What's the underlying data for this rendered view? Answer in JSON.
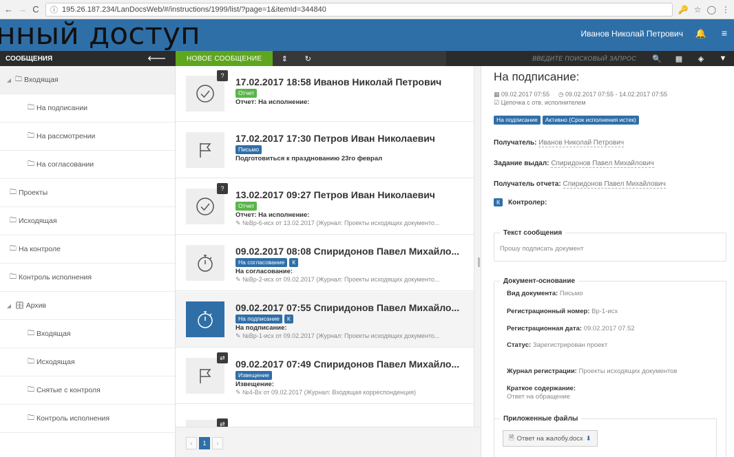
{
  "browser": {
    "url": "195.26.187.234/LanDocsWeb/#/instructions/1999/list/?page=1&itemId=344840"
  },
  "app": {
    "big_title": "нный доступ",
    "user_name": "Иванов Николай Петрович"
  },
  "toolbar": {
    "messages_label": "СООБЩЕНИЯ",
    "new_message_label": "НОВОЕ СООБЩЕНИЕ",
    "search_placeholder": "ВВЕДИТЕ ПОИСКОВЫЙ ЗАПРОС"
  },
  "sidebar": {
    "items": [
      {
        "label": "Входящая",
        "level": 0,
        "expanded": true
      },
      {
        "label": "На подписании",
        "level": 1
      },
      {
        "label": "На рассмотрении",
        "level": 1
      },
      {
        "label": "На согласовании",
        "level": 1
      },
      {
        "label": "Проекты",
        "level": 0
      },
      {
        "label": "Исходящая",
        "level": 0
      },
      {
        "label": "На контроле",
        "level": 0
      },
      {
        "label": "Контроль исполнения",
        "level": 0
      },
      {
        "label": "Архив",
        "level": 0,
        "expanded": true
      },
      {
        "label": "Входящая",
        "level": 1
      },
      {
        "label": "Исходящая",
        "level": 1
      },
      {
        "label": "Снятые с контроля",
        "level": 1
      },
      {
        "label": "Контроль исполнения",
        "level": 1
      }
    ]
  },
  "messages": [
    {
      "title": "17.02.2017 18:58 Иванов Николай Петрович",
      "tags": [
        {
          "text": "Отчет",
          "color": "green"
        }
      ],
      "subtitle": "Отчет: На исполнение:",
      "ref": "",
      "icon": "check-circle-icon",
      "badge": "?"
    },
    {
      "title": "17.02.2017 17:30 Петров Иван Николаевич",
      "tags": [
        {
          "text": "Письмо",
          "color": "blue"
        }
      ],
      "subtitle": "Подготовиться к празднованию 23го феврал",
      "ref": "",
      "icon": "flag-icon",
      "badge": ""
    },
    {
      "title": "13.02.2017 09:27 Петров Иван Николаевич",
      "tags": [
        {
          "text": "Отчет",
          "color": "green"
        }
      ],
      "subtitle": "Отчет: На исполнение:",
      "ref": "№Вр-6-исх от 13.02.2017 (Журнал: Проекты исходящих документо...",
      "icon": "check-circle-icon",
      "badge": "?"
    },
    {
      "title": "09.02.2017 08:08 Спиридонов Павел Михайло...",
      "tags": [
        {
          "text": "На согласование",
          "color": "blue"
        },
        {
          "text": "К",
          "color": "blue"
        }
      ],
      "subtitle": "На согласование:",
      "ref": "№Вр-2-исх от 09.02.2017 (Журнал: Проекты исходящих документо...",
      "icon": "stopwatch-icon",
      "badge": ""
    },
    {
      "title": "09.02.2017 07:55 Спиридонов Павел Михайло...",
      "tags": [
        {
          "text": "На подписание",
          "color": "blue"
        },
        {
          "text": "К",
          "color": "blue"
        }
      ],
      "subtitle": "На подписание:",
      "ref": "№Вр-1-исх от 09.02.2017 (Журнал: Проекты исходящих документо...",
      "icon": "stopwatch-icon",
      "badge": "",
      "selected": true
    },
    {
      "title": "09.02.2017 07:49 Спиридонов Павел Михайло...",
      "tags": [
        {
          "text": "Извещение",
          "color": "blue"
        }
      ],
      "subtitle": "Извещение:",
      "ref": "№4-Вх от 09.02.2017 (Журнал: Входящая корреспонденция)",
      "icon": "flag-icon",
      "badge": "⇄"
    }
  ],
  "pager": {
    "prev": "‹",
    "current": "1",
    "next": "›"
  },
  "detail": {
    "title": "На подписание:",
    "created": "09.02.2017 07:55",
    "period": "09.02.2017 07:55 - 14.02.2017 07:55",
    "chain": "Цепочка с отв. исполнителем",
    "tags": [
      "На подписание",
      "Активно (Срок исполнения истек)"
    ],
    "recipient_label": "Получатель:",
    "recipient": "Иванов Николай Петрович",
    "issuer_label": "Задание выдал:",
    "issuer": "Спиридонов Павел Михайлович",
    "report_recipient_label": "Получатель отчета:",
    "report_recipient": "Спиридонов Павел Михайлович",
    "controller_badge": "К",
    "controller_label": "Контролер:",
    "text_legend": "Текст сообщения",
    "text_value": "Прошу подписать документ",
    "doc_legend": "Документ-основание",
    "doc_type_label": "Вид документа:",
    "doc_type": "Письмо",
    "reg_num_label": "Регистрационный номер:",
    "reg_num": "Вр-1-исх",
    "reg_date_label": "Регистрационная дата:",
    "reg_date": "09.02.2017 07.52",
    "status_label": "Статус:",
    "status": "Зарегистрирован проект",
    "journal_label": "Журнал регистрации:",
    "journal": "Проекты исходящих документов",
    "summary_label": "Краткое содержание:",
    "summary": "Ответ на обращение",
    "files_legend": "Приложенные файлы",
    "file_name": "Ответ на жалобу.docx"
  }
}
